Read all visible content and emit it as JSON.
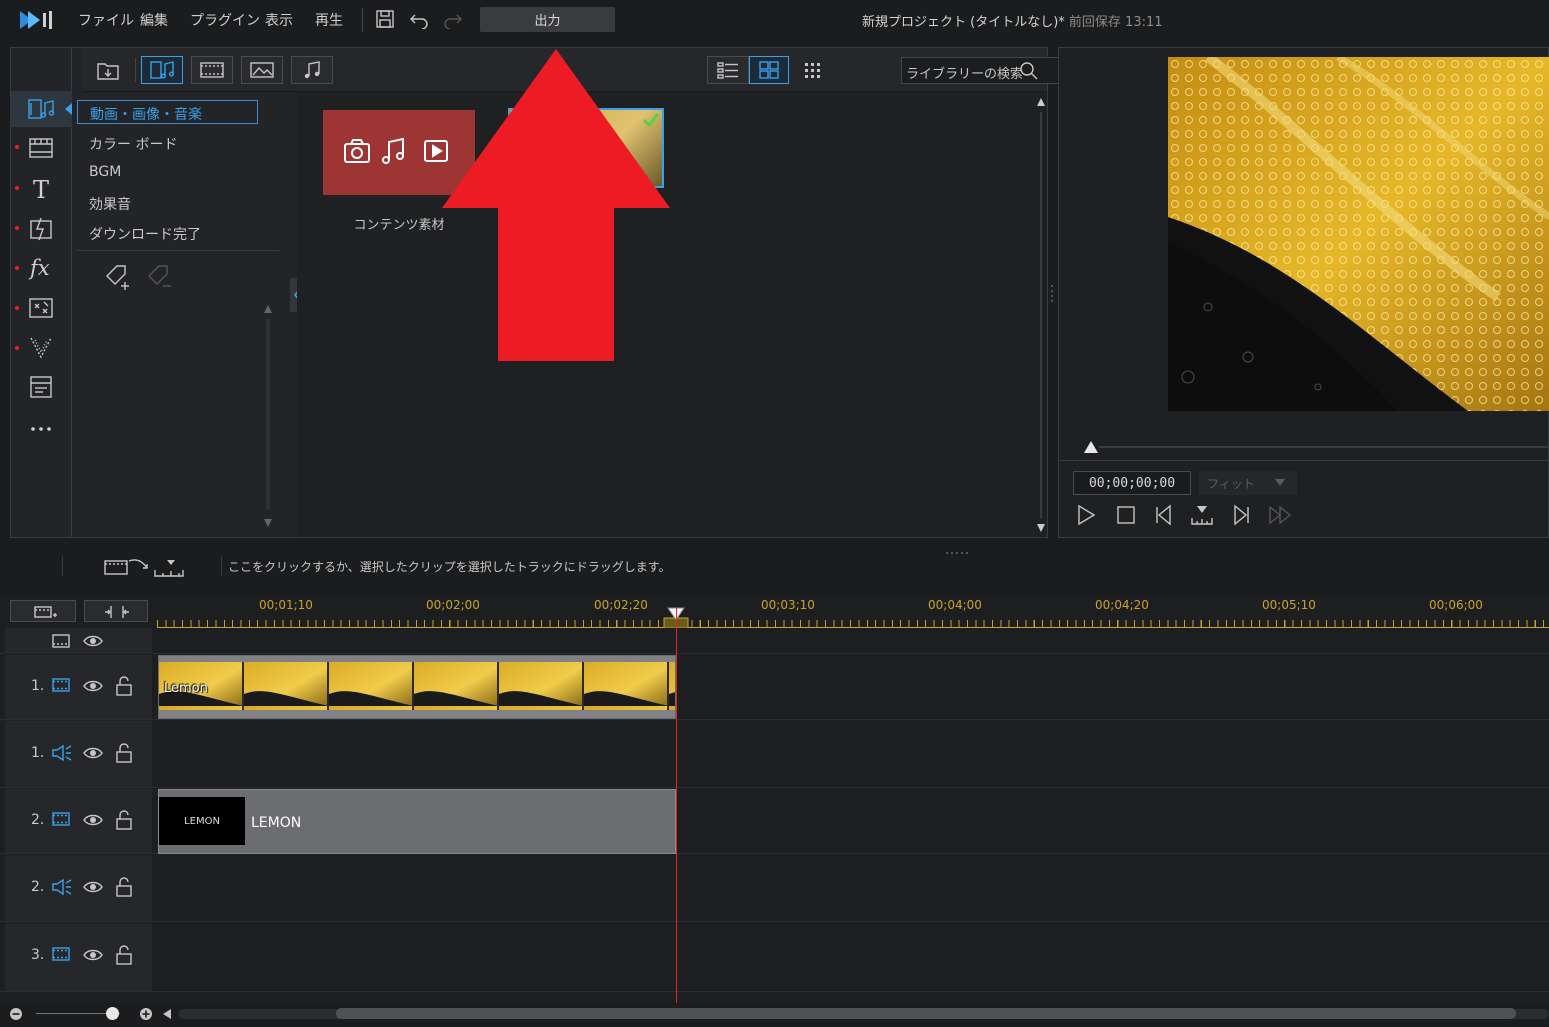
{
  "menubar": {
    "items": [
      "ファイル",
      "編集",
      "プラグイン",
      "表示",
      "再生"
    ],
    "output_label": "出力",
    "project_title": "新規プロジェクト (タイトルなし)*",
    "last_saved": "前回保存 13:11"
  },
  "library": {
    "categories": [
      "動画・画像・音楽",
      "カラー ボード",
      "BGM",
      "効果音",
      "ダウンロード完了"
    ],
    "search_placeholder": "ライブラリーの検索",
    "content_tile_label": "コンテンツ素材"
  },
  "preview": {
    "timecode": "00;00;00;00",
    "fit_label": "フィット"
  },
  "hint": "ここをクリックするか、選択したクリップを選択したトラックにドラッグします。",
  "timeline": {
    "ruler_labels": [
      "00;01;10",
      "00;02;00",
      "00;02;20",
      "00;03;10",
      "00;04;00",
      "00;04;20",
      "00;05;10",
      "00;06;00"
    ],
    "tracks": [
      {
        "num": "1.",
        "kind": "video"
      },
      {
        "num": "1.",
        "kind": "audio"
      },
      {
        "num": "2.",
        "kind": "video"
      },
      {
        "num": "2.",
        "kind": "audio"
      },
      {
        "num": "3.",
        "kind": "video"
      }
    ],
    "clip_video_label": "Lemon",
    "clip_title_thumb": "LEMON",
    "clip_title_label": "LEMON"
  },
  "colors": {
    "accent": "#3aa0e8",
    "annotation": "#ed1c24",
    "ruler": "#c9a227",
    "content_tile": "#9e3535"
  }
}
